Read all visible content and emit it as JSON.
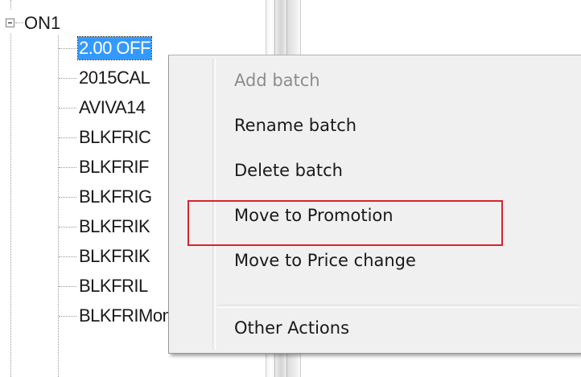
{
  "tree": {
    "root": {
      "label": "ON1"
    },
    "items": [
      {
        "label": "2.00 OFF",
        "selected": true
      },
      {
        "label": "2015CAL"
      },
      {
        "label": "AVIVA14"
      },
      {
        "label": "BLKFRIC"
      },
      {
        "label": "BLKFRIF"
      },
      {
        "label": "BLKFRIG"
      },
      {
        "label": "BLKFRIK"
      },
      {
        "label": "BLKFRIK"
      },
      {
        "label": "BLKFRIL"
      },
      {
        "label": "BLKFRIMom"
      }
    ]
  },
  "context_menu": {
    "items": [
      {
        "label": "Add batch",
        "enabled": false
      },
      {
        "label": "Rename batch",
        "enabled": true
      },
      {
        "label": "Delete batch",
        "enabled": true
      },
      {
        "label": "Move to Promotion",
        "enabled": true,
        "highlighted": true
      },
      {
        "label": "Move to Price change",
        "enabled": true
      },
      {
        "label": "Other Actions",
        "enabled": true
      }
    ]
  },
  "colors": {
    "selection": "#3399ff",
    "highlight_box": "#d9232a",
    "menu_background": "#f0f0f0",
    "disabled_text": "#8d8d8d"
  },
  "icons": {
    "tree_expander": "minus-box-icon"
  }
}
